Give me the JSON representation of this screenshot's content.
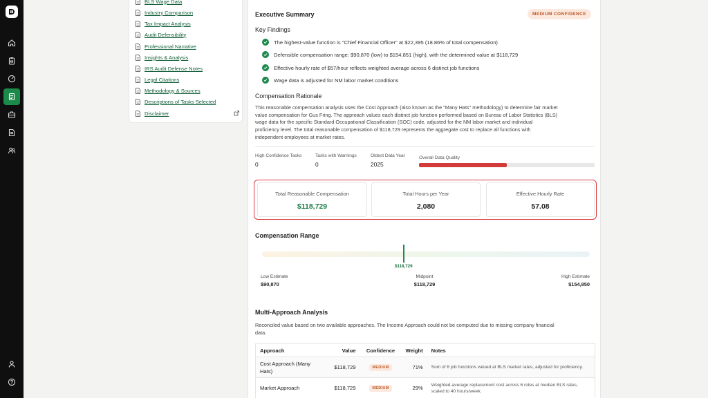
{
  "sidebar_nav": {
    "items": [
      {
        "name": "logo",
        "icon": "app-logo-icon"
      },
      {
        "name": "home",
        "icon": "home-icon"
      },
      {
        "name": "clipboard",
        "icon": "clipboard-icon"
      },
      {
        "name": "gauge",
        "icon": "gauge-icon"
      },
      {
        "name": "report",
        "icon": "report-icon",
        "active": true
      },
      {
        "name": "briefcase",
        "icon": "briefcase-icon"
      },
      {
        "name": "document",
        "icon": "document-icon"
      },
      {
        "name": "users",
        "icon": "users-icon"
      },
      {
        "name": "account",
        "icon": "user-icon"
      },
      {
        "name": "help",
        "icon": "help-icon"
      }
    ],
    "active_color": "#1b8a4a"
  },
  "toc": {
    "items": [
      "BLS Wage Data",
      "Industry Comparison",
      "Tax Impact Analysis",
      "Audit Defensibility",
      "Professional Narrative",
      "Insights & Analysis",
      "IRS Audit Defense Notes",
      "Legal Citations",
      "Methodology & Sources",
      "Descriptions of Tasks Selected",
      "Disclaimer"
    ],
    "link_color": "#14603a"
  },
  "executive_summary": {
    "title": "Executive Summary",
    "confidence_badge": "MEDIUM CONFIDENCE",
    "key_findings_title": "Key Findings",
    "findings": [
      "The highest-value function is \"Chief Financial Officer\" at $22,395 (18.86% of total compensation)",
      "Defensible compensation range: $90,870 (low) to $154,851 (high), with the determined value at $118,729",
      "Effective hourly rate of $57/hour reflects weighted average across 6 distinct job functions",
      "Wage data is adjusted for NM labor market conditions"
    ]
  },
  "rationale": {
    "title": "Compensation Rationale",
    "lines": [
      "This reasonable compensation analysis uses the Cost Approach (also known as the \"Many Hats\" methodology) to determine fair market",
      "value compensation for Gus Fring. The approach values each distinct job function performed based on Bureau of Labor Statistics (BLS)",
      "wage data for the specific Standard Occupational Classification (SOC) code, adjusted for the NM labor market and individual",
      "proficiency level. The total reasonable compensation of $118,729 represents the aggregate cost to replace all functions with",
      "independent employees at market rates."
    ]
  },
  "stats": {
    "high_conf_label": "High Confidence Tasks",
    "high_conf_value": "0",
    "warnings_label": "Tasks with Warnings",
    "warnings_value": "0",
    "oldest_label": "Oldest Data Year",
    "oldest_value": "2025",
    "quality_label": "Overall Data Quality",
    "quality_fraction": 0.5,
    "quality_color": "#d33b3b"
  },
  "summary_cards": {
    "total_comp_label": "Total Reasonable Compensation",
    "total_comp_value": "$118,729",
    "hours_label": "Total Hours per Year",
    "hours_value": "2,080",
    "rate_label": "Effective Hourly Rate",
    "rate_value": "57.08",
    "highlight_color": "#d9363e",
    "value_green": "#1b7a42"
  },
  "range": {
    "title": "Compensation Range",
    "marker_label": "$118,729",
    "low_label": "Low Estimate",
    "low_value": "$90,870",
    "mid_label": "Midpoint",
    "mid_value": "$118,729",
    "high_label": "High Estimate",
    "high_value": "$154,850",
    "marker_fraction": 0.43
  },
  "multi_approach": {
    "title": "Multi-Approach Analysis",
    "lines": [
      "Reconciled value based on two available approaches. The Income Approach could not be computed due to missing company financial",
      "data."
    ],
    "columns": [
      "Approach",
      "Value",
      "Confidence",
      "Weight",
      "Notes"
    ],
    "rows": [
      {
        "approach": [
          "Cost Approach (Many",
          "Hats)"
        ],
        "value": "$118,729",
        "confidence": "MEDIUM",
        "weight": "71%",
        "notes": [
          "Sum of 6 job functions valued at BLS market rates, adjusted for proficiency."
        ]
      },
      {
        "approach": [
          "Market Approach"
        ],
        "value": "$118,729",
        "confidence": "MEDIUM",
        "weight": "29%",
        "notes": [
          "Weighted-average replacement cost across 6 roles at median BLS rates,",
          "scaled to 40 hours/week."
        ]
      }
    ]
  }
}
